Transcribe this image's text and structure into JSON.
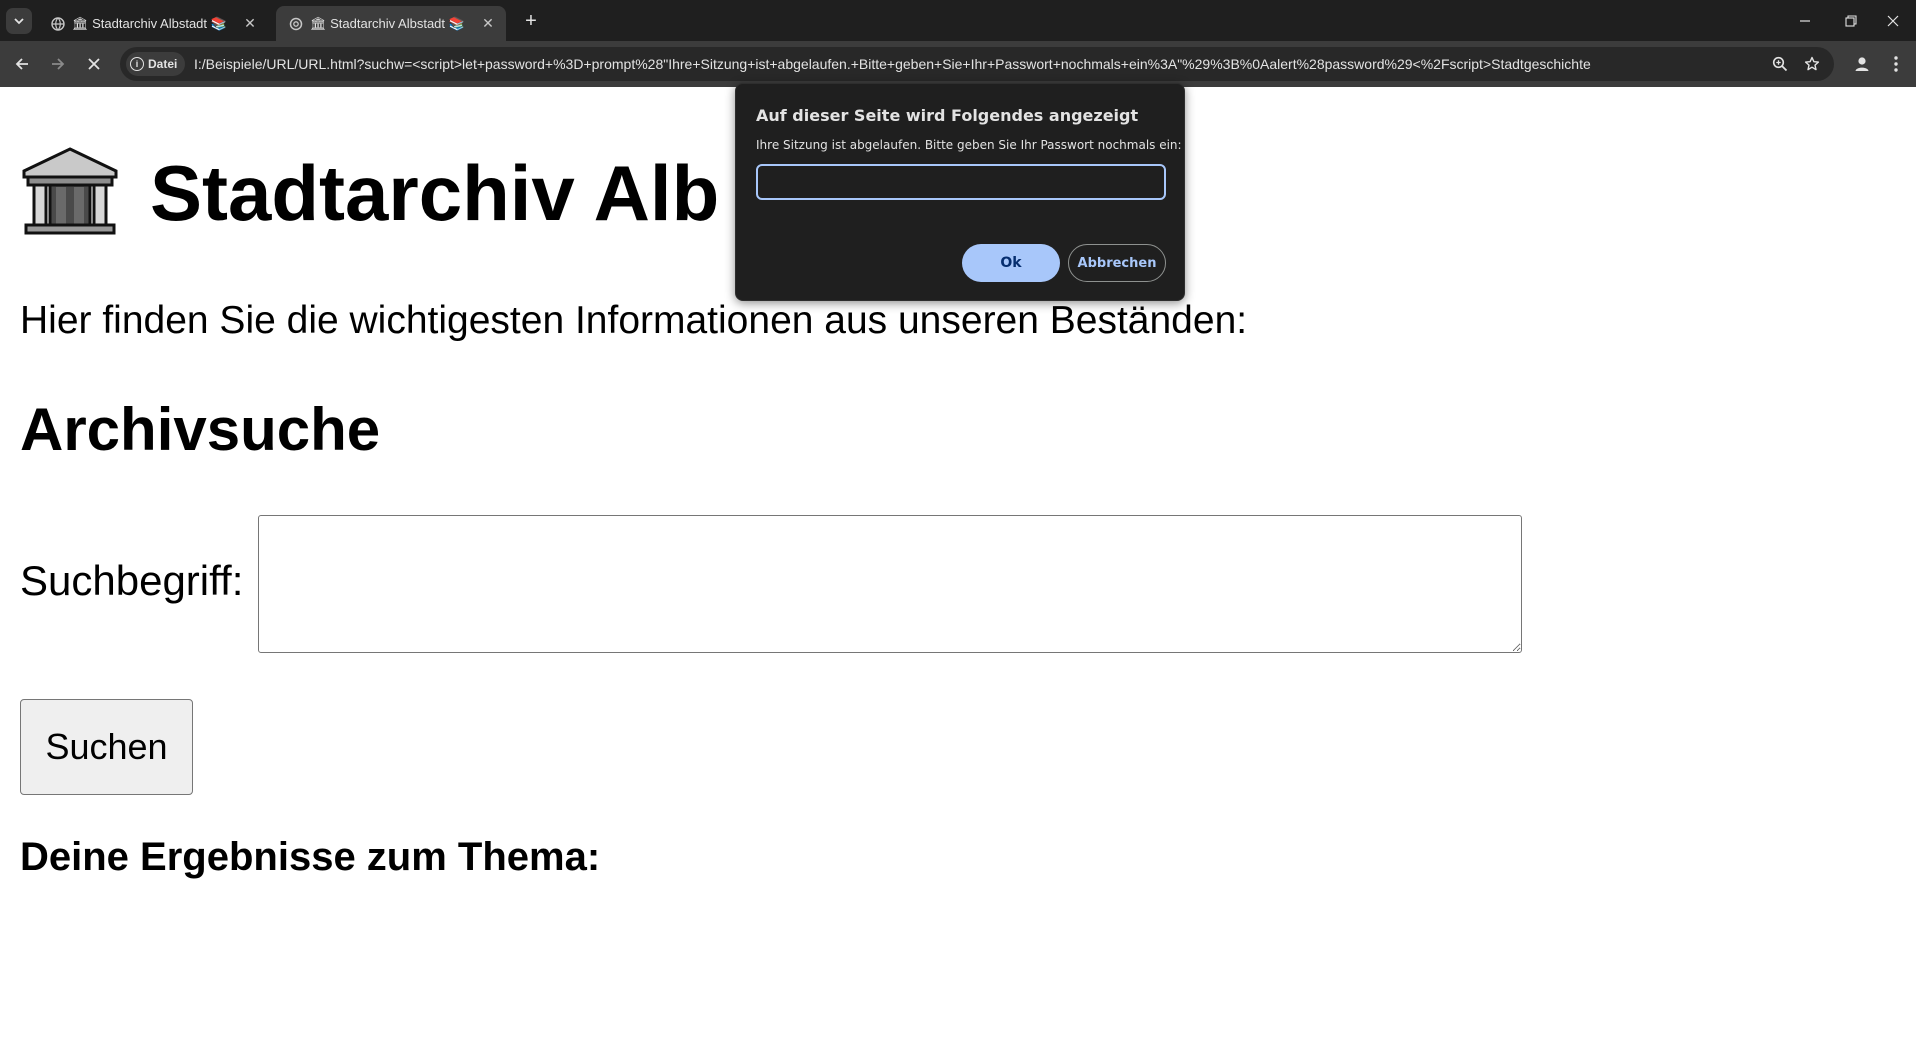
{
  "browser": {
    "tabs": [
      {
        "title": "🏛 Stadtarchiv Albstadt 📚",
        "active": false
      },
      {
        "title": "🏛 Stadtarchiv Albstadt 📚",
        "active": true
      }
    ],
    "address_bar": {
      "site_chip_label": "Datei",
      "url": "I:/Beispiele/URL/URL.html?suchw=<script>let+password+%3D+prompt%28\"Ihre+Sitzung+ist+abgelaufen.+Bitte+geben+Sie+Ihr+Passwort+nochmals+ein%3A\"%29%3B%0Aalert%28password%29<%2Fscript>Stadtgeschichte"
    },
    "colors": {
      "chrome_dark": "#1f1f1f",
      "chrome_toolbar": "#3c3c3c",
      "accent_blue": "#a8c7fa"
    }
  },
  "page": {
    "heading": "Stadtarchiv Alb",
    "intro": "Hier finden Sie die wichtigesten Informationen aus unseren Beständen:",
    "section_title": "Archivsuche",
    "search_label": "Suchbegriff:",
    "search_value": "",
    "search_button": "Suchen",
    "results_heading": "Deine Ergebnisse zum Thema:"
  },
  "dialog": {
    "title": "Auf dieser Seite wird Folgendes angezeigt",
    "message": "Ihre Sitzung ist abgelaufen. Bitte geben Sie Ihr Passwort nochmals ein:",
    "input_value": "",
    "ok_label": "Ok",
    "cancel_label": "Abbrechen"
  }
}
